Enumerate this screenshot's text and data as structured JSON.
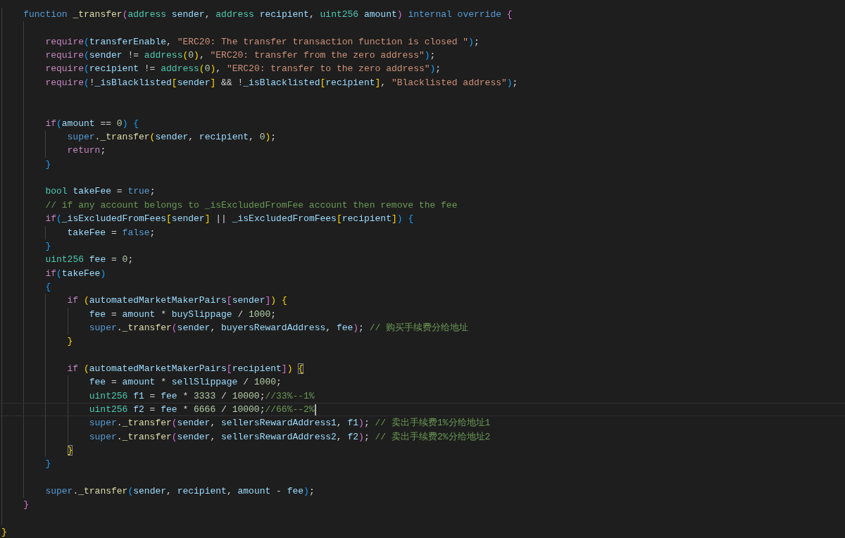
{
  "editor": {
    "lines": [
      {
        "children": [
          {
            "tokens": [
              {
                "text": "function ",
                "kind": "keyword"
              },
              {
                "text": "_transfer",
                "kind": "function"
              },
              {
                "text": "(",
                "kind": "bracket2"
              },
              {
                "text": "address ",
                "kind": "type"
              },
              {
                "text": "sender",
                "kind": "variable"
              },
              {
                "text": ", ",
                "kind": "plain"
              },
              {
                "text": "address ",
                "kind": "type"
              },
              {
                "text": "recipient",
                "kind": "variable"
              },
              {
                "text": ", ",
                "kind": "plain"
              },
              {
                "text": "uint256 ",
                "kind": "type"
              },
              {
                "text": "amount",
                "kind": "variable"
              },
              {
                "text": ")",
                "kind": "bracket2"
              },
              {
                "text": " internal override ",
                "kind": "keyword"
              },
              {
                "text": "{",
                "kind": "bracket2"
              }
            ],
            "children": [
              {
                "blank": true
              },
              {
                "tokens": [
                  {
                    "text": "require",
                    "kind": "control"
                  },
                  {
                    "text": "(",
                    "kind": "bracket3"
                  },
                  {
                    "text": "transferEnable",
                    "kind": "variable"
                  },
                  {
                    "text": ", ",
                    "kind": "plain"
                  },
                  {
                    "text": "\"ERC20: The transfer transaction function is closed \"",
                    "kind": "string"
                  },
                  {
                    "text": ")",
                    "kind": "bracket3"
                  },
                  {
                    "text": ";",
                    "kind": "plain"
                  }
                ]
              },
              {
                "tokens": [
                  {
                    "text": "require",
                    "kind": "control"
                  },
                  {
                    "text": "(",
                    "kind": "bracket3"
                  },
                  {
                    "text": "sender",
                    "kind": "variable"
                  },
                  {
                    "text": " != ",
                    "kind": "plain"
                  },
                  {
                    "text": "address",
                    "kind": "type"
                  },
                  {
                    "text": "(",
                    "kind": "bracket1"
                  },
                  {
                    "text": "0",
                    "kind": "number"
                  },
                  {
                    "text": ")",
                    "kind": "bracket1"
                  },
                  {
                    "text": ", ",
                    "kind": "plain"
                  },
                  {
                    "text": "\"ERC20: transfer from the zero address\"",
                    "kind": "string"
                  },
                  {
                    "text": ")",
                    "kind": "bracket3"
                  },
                  {
                    "text": ";",
                    "kind": "plain"
                  }
                ]
              },
              {
                "tokens": [
                  {
                    "text": "require",
                    "kind": "control"
                  },
                  {
                    "text": "(",
                    "kind": "bracket3"
                  },
                  {
                    "text": "recipient",
                    "kind": "variable"
                  },
                  {
                    "text": " != ",
                    "kind": "plain"
                  },
                  {
                    "text": "address",
                    "kind": "type"
                  },
                  {
                    "text": "(",
                    "kind": "bracket1"
                  },
                  {
                    "text": "0",
                    "kind": "number"
                  },
                  {
                    "text": ")",
                    "kind": "bracket1"
                  },
                  {
                    "text": ", ",
                    "kind": "plain"
                  },
                  {
                    "text": "\"ERC20: transfer to the zero address\"",
                    "kind": "string"
                  },
                  {
                    "text": ")",
                    "kind": "bracket3"
                  },
                  {
                    "text": ";",
                    "kind": "plain"
                  }
                ]
              },
              {
                "tokens": [
                  {
                    "text": "require",
                    "kind": "control"
                  },
                  {
                    "text": "(",
                    "kind": "bracket3"
                  },
                  {
                    "text": "!",
                    "kind": "plain"
                  },
                  {
                    "text": "_isBlacklisted",
                    "kind": "variable"
                  },
                  {
                    "text": "[",
                    "kind": "bracket1"
                  },
                  {
                    "text": "sender",
                    "kind": "variable"
                  },
                  {
                    "text": "]",
                    "kind": "bracket1"
                  },
                  {
                    "text": " && !",
                    "kind": "plain"
                  },
                  {
                    "text": "_isBlacklisted",
                    "kind": "variable"
                  },
                  {
                    "text": "[",
                    "kind": "bracket1"
                  },
                  {
                    "text": "recipient",
                    "kind": "variable"
                  },
                  {
                    "text": "]",
                    "kind": "bracket1"
                  },
                  {
                    "text": ", ",
                    "kind": "plain"
                  },
                  {
                    "text": "\"Blacklisted address\"",
                    "kind": "string"
                  },
                  {
                    "text": ")",
                    "kind": "bracket3"
                  },
                  {
                    "text": ";",
                    "kind": "plain"
                  }
                ]
              },
              {
                "blank": true
              },
              {
                "blank": true
              },
              {
                "tokens": [
                  {
                    "text": "if",
                    "kind": "control"
                  },
                  {
                    "text": "(",
                    "kind": "bracket3"
                  },
                  {
                    "text": "amount",
                    "kind": "variable"
                  },
                  {
                    "text": " == ",
                    "kind": "plain"
                  },
                  {
                    "text": "0",
                    "kind": "number"
                  },
                  {
                    "text": ") ",
                    "kind": "bracket3"
                  },
                  {
                    "text": "{",
                    "kind": "bracket3"
                  }
                ],
                "children": [
                  {
                    "tokens": [
                      {
                        "text": "super",
                        "kind": "keyword"
                      },
                      {
                        "text": ".",
                        "kind": "plain"
                      },
                      {
                        "text": "_transfer",
                        "kind": "function"
                      },
                      {
                        "text": "(",
                        "kind": "bracket1"
                      },
                      {
                        "text": "sender",
                        "kind": "variable"
                      },
                      {
                        "text": ", ",
                        "kind": "plain"
                      },
                      {
                        "text": "recipient",
                        "kind": "variable"
                      },
                      {
                        "text": ", ",
                        "kind": "plain"
                      },
                      {
                        "text": "0",
                        "kind": "number"
                      },
                      {
                        "text": ")",
                        "kind": "bracket1"
                      },
                      {
                        "text": ";",
                        "kind": "plain"
                      }
                    ]
                  },
                  {
                    "tokens": [
                      {
                        "text": "return",
                        "kind": "control"
                      },
                      {
                        "text": ";",
                        "kind": "plain"
                      }
                    ]
                  }
                ]
              },
              {
                "tokens": [
                  {
                    "text": "}",
                    "kind": "bracket3"
                  }
                ]
              },
              {
                "blank": true
              },
              {
                "tokens": [
                  {
                    "text": "bool ",
                    "kind": "type"
                  },
                  {
                    "text": "takeFee",
                    "kind": "variable"
                  },
                  {
                    "text": " = ",
                    "kind": "plain"
                  },
                  {
                    "text": "true",
                    "kind": "keyword"
                  },
                  {
                    "text": ";",
                    "kind": "plain"
                  }
                ]
              },
              {
                "tokens": [
                  {
                    "text": "// if any account belongs to _isExcludedFromFee account then remove the fee",
                    "kind": "comment"
                  }
                ]
              },
              {
                "tokens": [
                  {
                    "text": "if",
                    "kind": "control"
                  },
                  {
                    "text": "(",
                    "kind": "bracket3"
                  },
                  {
                    "text": "_isExcludedFromFees",
                    "kind": "variable"
                  },
                  {
                    "text": "[",
                    "kind": "bracket1"
                  },
                  {
                    "text": "sender",
                    "kind": "variable"
                  },
                  {
                    "text": "]",
                    "kind": "bracket1"
                  },
                  {
                    "text": " || ",
                    "kind": "plain"
                  },
                  {
                    "text": "_isExcludedFromFees",
                    "kind": "variable"
                  },
                  {
                    "text": "[",
                    "kind": "bracket1"
                  },
                  {
                    "text": "recipient",
                    "kind": "variable"
                  },
                  {
                    "text": "]",
                    "kind": "bracket1"
                  },
                  {
                    "text": ") ",
                    "kind": "bracket3"
                  },
                  {
                    "text": "{",
                    "kind": "bracket3"
                  }
                ],
                "children": [
                  {
                    "tokens": [
                      {
                        "text": "takeFee",
                        "kind": "variable"
                      },
                      {
                        "text": " = ",
                        "kind": "plain"
                      },
                      {
                        "text": "false",
                        "kind": "keyword"
                      },
                      {
                        "text": ";",
                        "kind": "plain"
                      }
                    ]
                  }
                ]
              },
              {
                "tokens": [
                  {
                    "text": "}",
                    "kind": "bracket3"
                  }
                ]
              },
              {
                "tokens": [
                  {
                    "text": "uint256 ",
                    "kind": "type"
                  },
                  {
                    "text": "fee",
                    "kind": "variable"
                  },
                  {
                    "text": " = ",
                    "kind": "plain"
                  },
                  {
                    "text": "0",
                    "kind": "number"
                  },
                  {
                    "text": ";",
                    "kind": "plain"
                  }
                ]
              },
              {
                "tokens": [
                  {
                    "text": "if",
                    "kind": "control"
                  },
                  {
                    "text": "(",
                    "kind": "bracket3"
                  },
                  {
                    "text": "takeFee",
                    "kind": "variable"
                  },
                  {
                    "text": ")",
                    "kind": "bracket3"
                  }
                ]
              },
              {
                "tokens": [
                  {
                    "text": "{",
                    "kind": "bracket3"
                  }
                ],
                "children": [
                  {
                    "tokens": [
                      {
                        "text": "if ",
                        "kind": "control"
                      },
                      {
                        "text": "(",
                        "kind": "bracket1"
                      },
                      {
                        "text": "automatedMarketMakerPairs",
                        "kind": "variable"
                      },
                      {
                        "text": "[",
                        "kind": "bracket2"
                      },
                      {
                        "text": "sender",
                        "kind": "variable"
                      },
                      {
                        "text": "]",
                        "kind": "bracket2"
                      },
                      {
                        "text": ") ",
                        "kind": "bracket1"
                      },
                      {
                        "text": "{",
                        "kind": "bracket1"
                      }
                    ],
                    "children": [
                      {
                        "tokens": [
                          {
                            "text": "fee",
                            "kind": "variable"
                          },
                          {
                            "text": " = ",
                            "kind": "plain"
                          },
                          {
                            "text": "amount",
                            "kind": "variable"
                          },
                          {
                            "text": " * ",
                            "kind": "plain"
                          },
                          {
                            "text": "buySlippage",
                            "kind": "variable"
                          },
                          {
                            "text": " / ",
                            "kind": "plain"
                          },
                          {
                            "text": "1000",
                            "kind": "number"
                          },
                          {
                            "text": ";",
                            "kind": "plain"
                          }
                        ]
                      },
                      {
                        "tokens": [
                          {
                            "text": "super",
                            "kind": "keyword"
                          },
                          {
                            "text": ".",
                            "kind": "plain"
                          },
                          {
                            "text": "_transfer",
                            "kind": "function"
                          },
                          {
                            "text": "(",
                            "kind": "bracket2"
                          },
                          {
                            "text": "sender",
                            "kind": "variable"
                          },
                          {
                            "text": ", ",
                            "kind": "plain"
                          },
                          {
                            "text": "buyersRewardAddress",
                            "kind": "variable"
                          },
                          {
                            "text": ", ",
                            "kind": "plain"
                          },
                          {
                            "text": "fee",
                            "kind": "variable"
                          },
                          {
                            "text": ")",
                            "kind": "bracket2"
                          },
                          {
                            "text": "; ",
                            "kind": "plain"
                          },
                          {
                            "text": "// 购买手续费分给地址",
                            "kind": "comment"
                          }
                        ]
                      }
                    ]
                  },
                  {
                    "tokens": [
                      {
                        "text": "}",
                        "kind": "bracket1"
                      }
                    ]
                  },
                  {
                    "blank": true
                  },
                  {
                    "tokens": [
                      {
                        "text": "if ",
                        "kind": "control"
                      },
                      {
                        "text": "(",
                        "kind": "bracket1"
                      },
                      {
                        "text": "automatedMarketMakerPairs",
                        "kind": "variable"
                      },
                      {
                        "text": "[",
                        "kind": "bracket2"
                      },
                      {
                        "text": "recipient",
                        "kind": "variable"
                      },
                      {
                        "text": "]",
                        "kind": "bracket2"
                      },
                      {
                        "text": ") ",
                        "kind": "bracket1"
                      },
                      {
                        "text": "{",
                        "kind": "bracket1",
                        "matched": true
                      }
                    ],
                    "children": [
                      {
                        "tokens": [
                          {
                            "text": "fee",
                            "kind": "variable"
                          },
                          {
                            "text": " = ",
                            "kind": "plain"
                          },
                          {
                            "text": "amount",
                            "kind": "variable"
                          },
                          {
                            "text": " * ",
                            "kind": "plain"
                          },
                          {
                            "text": "sellSlippage",
                            "kind": "variable"
                          },
                          {
                            "text": " / ",
                            "kind": "plain"
                          },
                          {
                            "text": "1000",
                            "kind": "number"
                          },
                          {
                            "text": ";",
                            "kind": "plain"
                          }
                        ]
                      },
                      {
                        "tokens": [
                          {
                            "text": "uint256 ",
                            "kind": "type"
                          },
                          {
                            "text": "f1",
                            "kind": "variable"
                          },
                          {
                            "text": " = ",
                            "kind": "plain"
                          },
                          {
                            "text": "fee",
                            "kind": "variable"
                          },
                          {
                            "text": " * ",
                            "kind": "plain"
                          },
                          {
                            "text": "3333",
                            "kind": "number"
                          },
                          {
                            "text": " / ",
                            "kind": "plain"
                          },
                          {
                            "text": "10000",
                            "kind": "number"
                          },
                          {
                            "text": ";",
                            "kind": "plain"
                          },
                          {
                            "text": "//33%--1%",
                            "kind": "comment"
                          }
                        ]
                      },
                      {
                        "cursor": true,
                        "tokens": [
                          {
                            "text": "uint256 ",
                            "kind": "type"
                          },
                          {
                            "text": "f2",
                            "kind": "variable"
                          },
                          {
                            "text": " = ",
                            "kind": "plain"
                          },
                          {
                            "text": "fee",
                            "kind": "variable"
                          },
                          {
                            "text": " * ",
                            "kind": "plain"
                          },
                          {
                            "text": "6666",
                            "kind": "number"
                          },
                          {
                            "text": " / ",
                            "kind": "plain"
                          },
                          {
                            "text": "10000",
                            "kind": "number"
                          },
                          {
                            "text": ";",
                            "kind": "plain"
                          },
                          {
                            "text": "//66%--2%",
                            "kind": "comment"
                          }
                        ]
                      },
                      {
                        "tokens": [
                          {
                            "text": "super",
                            "kind": "keyword"
                          },
                          {
                            "text": ".",
                            "kind": "plain"
                          },
                          {
                            "text": "_transfer",
                            "kind": "function"
                          },
                          {
                            "text": "(",
                            "kind": "bracket2"
                          },
                          {
                            "text": "sender",
                            "kind": "variable"
                          },
                          {
                            "text": ", ",
                            "kind": "plain"
                          },
                          {
                            "text": "sellersRewardAddress1",
                            "kind": "variable"
                          },
                          {
                            "text": ", ",
                            "kind": "plain"
                          },
                          {
                            "text": "f1",
                            "kind": "variable"
                          },
                          {
                            "text": ")",
                            "kind": "bracket2"
                          },
                          {
                            "text": "; ",
                            "kind": "plain"
                          },
                          {
                            "text": "// 卖出手续费1%分给地址1",
                            "kind": "comment"
                          }
                        ]
                      },
                      {
                        "tokens": [
                          {
                            "text": "super",
                            "kind": "keyword"
                          },
                          {
                            "text": ".",
                            "kind": "plain"
                          },
                          {
                            "text": "_transfer",
                            "kind": "function"
                          },
                          {
                            "text": "(",
                            "kind": "bracket2"
                          },
                          {
                            "text": "sender",
                            "kind": "variable"
                          },
                          {
                            "text": ", ",
                            "kind": "plain"
                          },
                          {
                            "text": "sellersRewardAddress2",
                            "kind": "variable"
                          },
                          {
                            "text": ", ",
                            "kind": "plain"
                          },
                          {
                            "text": "f2",
                            "kind": "variable"
                          },
                          {
                            "text": ")",
                            "kind": "bracket2"
                          },
                          {
                            "text": "; ",
                            "kind": "plain"
                          },
                          {
                            "text": "// 卖出手续费2%分给地址2",
                            "kind": "comment"
                          }
                        ]
                      }
                    ]
                  },
                  {
                    "tokens": [
                      {
                        "text": "}",
                        "kind": "bracket1",
                        "matched": true
                      }
                    ]
                  }
                ]
              },
              {
                "tokens": [
                  {
                    "text": "}",
                    "kind": "bracket3"
                  }
                ]
              },
              {
                "blank": true
              },
              {
                "tokens": [
                  {
                    "text": "super",
                    "kind": "keyword"
                  },
                  {
                    "text": ".",
                    "kind": "plain"
                  },
                  {
                    "text": "_transfer",
                    "kind": "function"
                  },
                  {
                    "text": "(",
                    "kind": "bracket3"
                  },
                  {
                    "text": "sender",
                    "kind": "variable"
                  },
                  {
                    "text": ", ",
                    "kind": "plain"
                  },
                  {
                    "text": "recipient",
                    "kind": "variable"
                  },
                  {
                    "text": ", ",
                    "kind": "plain"
                  },
                  {
                    "text": "amount",
                    "kind": "variable"
                  },
                  {
                    "text": " - ",
                    "kind": "plain"
                  },
                  {
                    "text": "fee",
                    "kind": "variable"
                  },
                  {
                    "text": ")",
                    "kind": "bracket3"
                  },
                  {
                    "text": ";",
                    "kind": "plain"
                  }
                ]
              }
            ]
          },
          {
            "tokens": [
              {
                "text": "}",
                "kind": "bracket2"
              }
            ]
          },
          {
            "blank": true
          }
        ]
      },
      {
        "tokens": [
          {
            "text": "}",
            "kind": "bracket1"
          }
        ]
      }
    ]
  }
}
